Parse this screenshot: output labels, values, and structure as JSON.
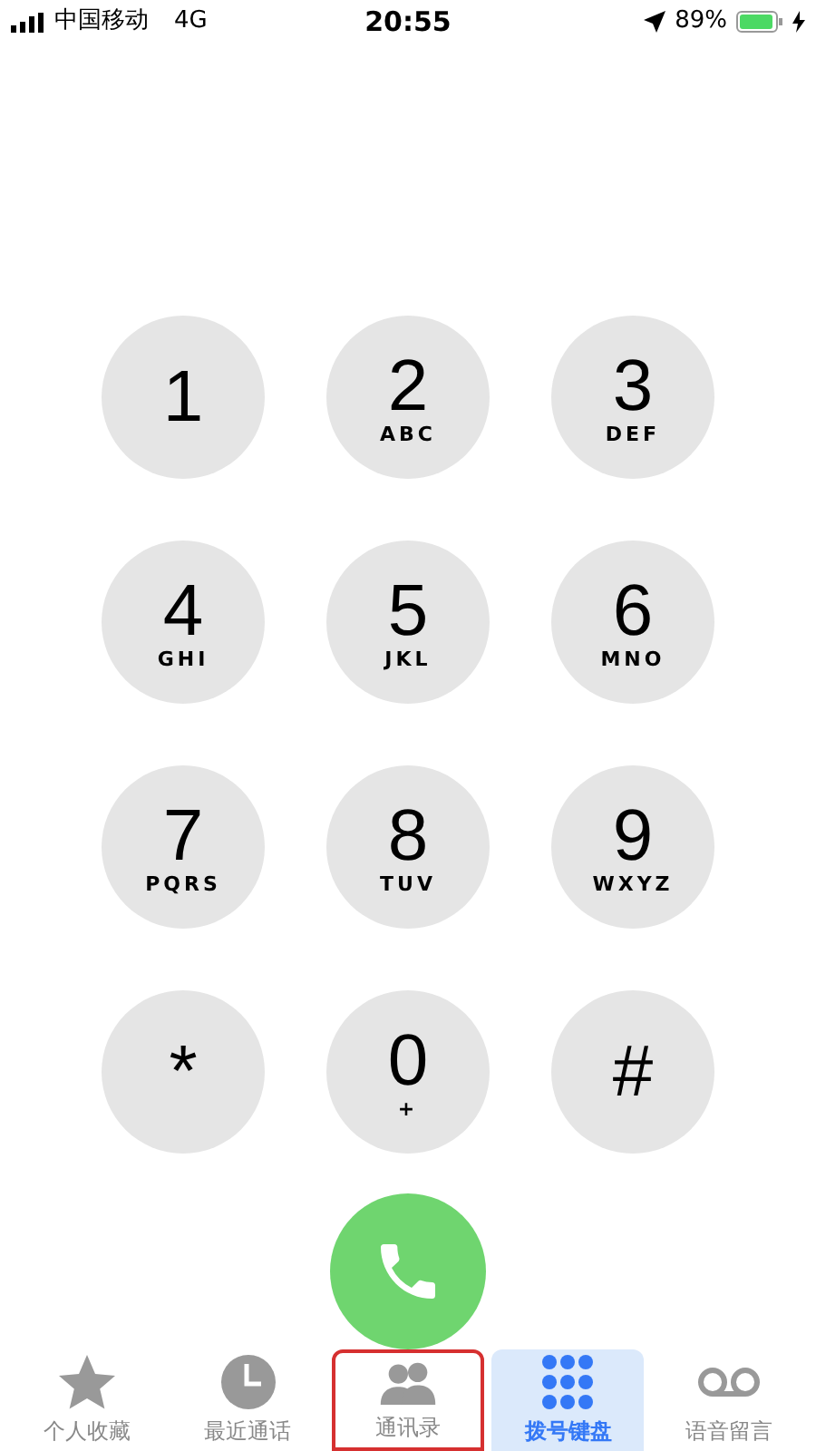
{
  "status_bar": {
    "carrier": "中国移动",
    "network": "4G",
    "time": "20:55",
    "battery_percent": "89%"
  },
  "keypad": [
    {
      "digit": "1"
    },
    {
      "digit": "2",
      "letters": "ABC"
    },
    {
      "digit": "3",
      "letters": "DEF"
    },
    {
      "digit": "4",
      "letters": "GHI"
    },
    {
      "digit": "5",
      "letters": "JKL"
    },
    {
      "digit": "6",
      "letters": "MNO"
    },
    {
      "digit": "7",
      "letters": "PQRS"
    },
    {
      "digit": "8",
      "letters": "TUV"
    },
    {
      "digit": "9",
      "letters": "WXYZ"
    },
    {
      "digit": "*"
    },
    {
      "digit": "0",
      "letters": "+"
    },
    {
      "digit": "#"
    }
  ],
  "tabs": [
    {
      "kind": "favorites",
      "label": "个人收藏",
      "selected": false,
      "highlighted": false
    },
    {
      "kind": "recents",
      "label": "最近通话",
      "selected": false,
      "highlighted": false
    },
    {
      "kind": "contacts",
      "label": "通讯录",
      "selected": false,
      "highlighted": true
    },
    {
      "kind": "keypad",
      "label": "拨号键盘",
      "selected": true,
      "highlighted": false
    },
    {
      "kind": "voicemail",
      "label": "语音留言",
      "selected": false,
      "highlighted": false
    }
  ]
}
